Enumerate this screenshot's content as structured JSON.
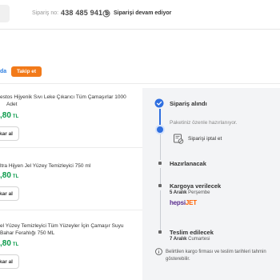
{
  "header": {
    "order_label": "Sipariş no:",
    "order_number": "438 485 941 5",
    "status_text": "Siparişi devam ediyor"
  },
  "seller": {
    "name": "da",
    "follow_label": "Takip et"
  },
  "products": [
    {
      "name": "estos Hijyenik Sıvı Leke Çıkarıcı Tüm Çamaşırlar 1000",
      "qty": "Adet",
      "price": ",80",
      "currency": "TL",
      "button_label": "kar al"
    },
    {
      "name": "ltra Hijyen Jel Yüzey Temizleyici 750 ml",
      "price": ",80",
      "currency": "TL",
      "button_label": "kar al"
    },
    {
      "name": "el Yüzey Temizleyici Tüm Yüzeyler İçin Çamaşır Suyu",
      "name2": "Bahar Ferahlığı 750 ML",
      "price": ",80",
      "currency": "TL",
      "button_label": "kar al"
    }
  ],
  "timeline": {
    "received_title": "Sipariş alındı",
    "received_note": "Paketiniz özenle hazırlanıyor.",
    "cancel_label": "Siparişi iptal et",
    "preparing_title": "Hazırlanacak",
    "cargo_title": "Kargoya verilecek",
    "cargo_date": "5 Aralık",
    "cargo_day": "Perşembe",
    "carrier_main": "hepsi",
    "carrier_accent": "JET",
    "delivery_title": "Teslim edilecek",
    "delivery_date": "7 Aralık",
    "delivery_day": "Cumartesi",
    "info_line1": "Belirtilen kargo firması ve teslim tarihleri tahmin",
    "info_line2": "gösterebilir."
  },
  "colors": {
    "accent": "#f27a1a",
    "link": "#2a7de1",
    "price": "#0a9a4a",
    "progress": "#2f6fe0"
  },
  "icons": [
    "clock-icon",
    "check-circle-icon",
    "cancel-order-icon",
    "info-icon"
  ]
}
